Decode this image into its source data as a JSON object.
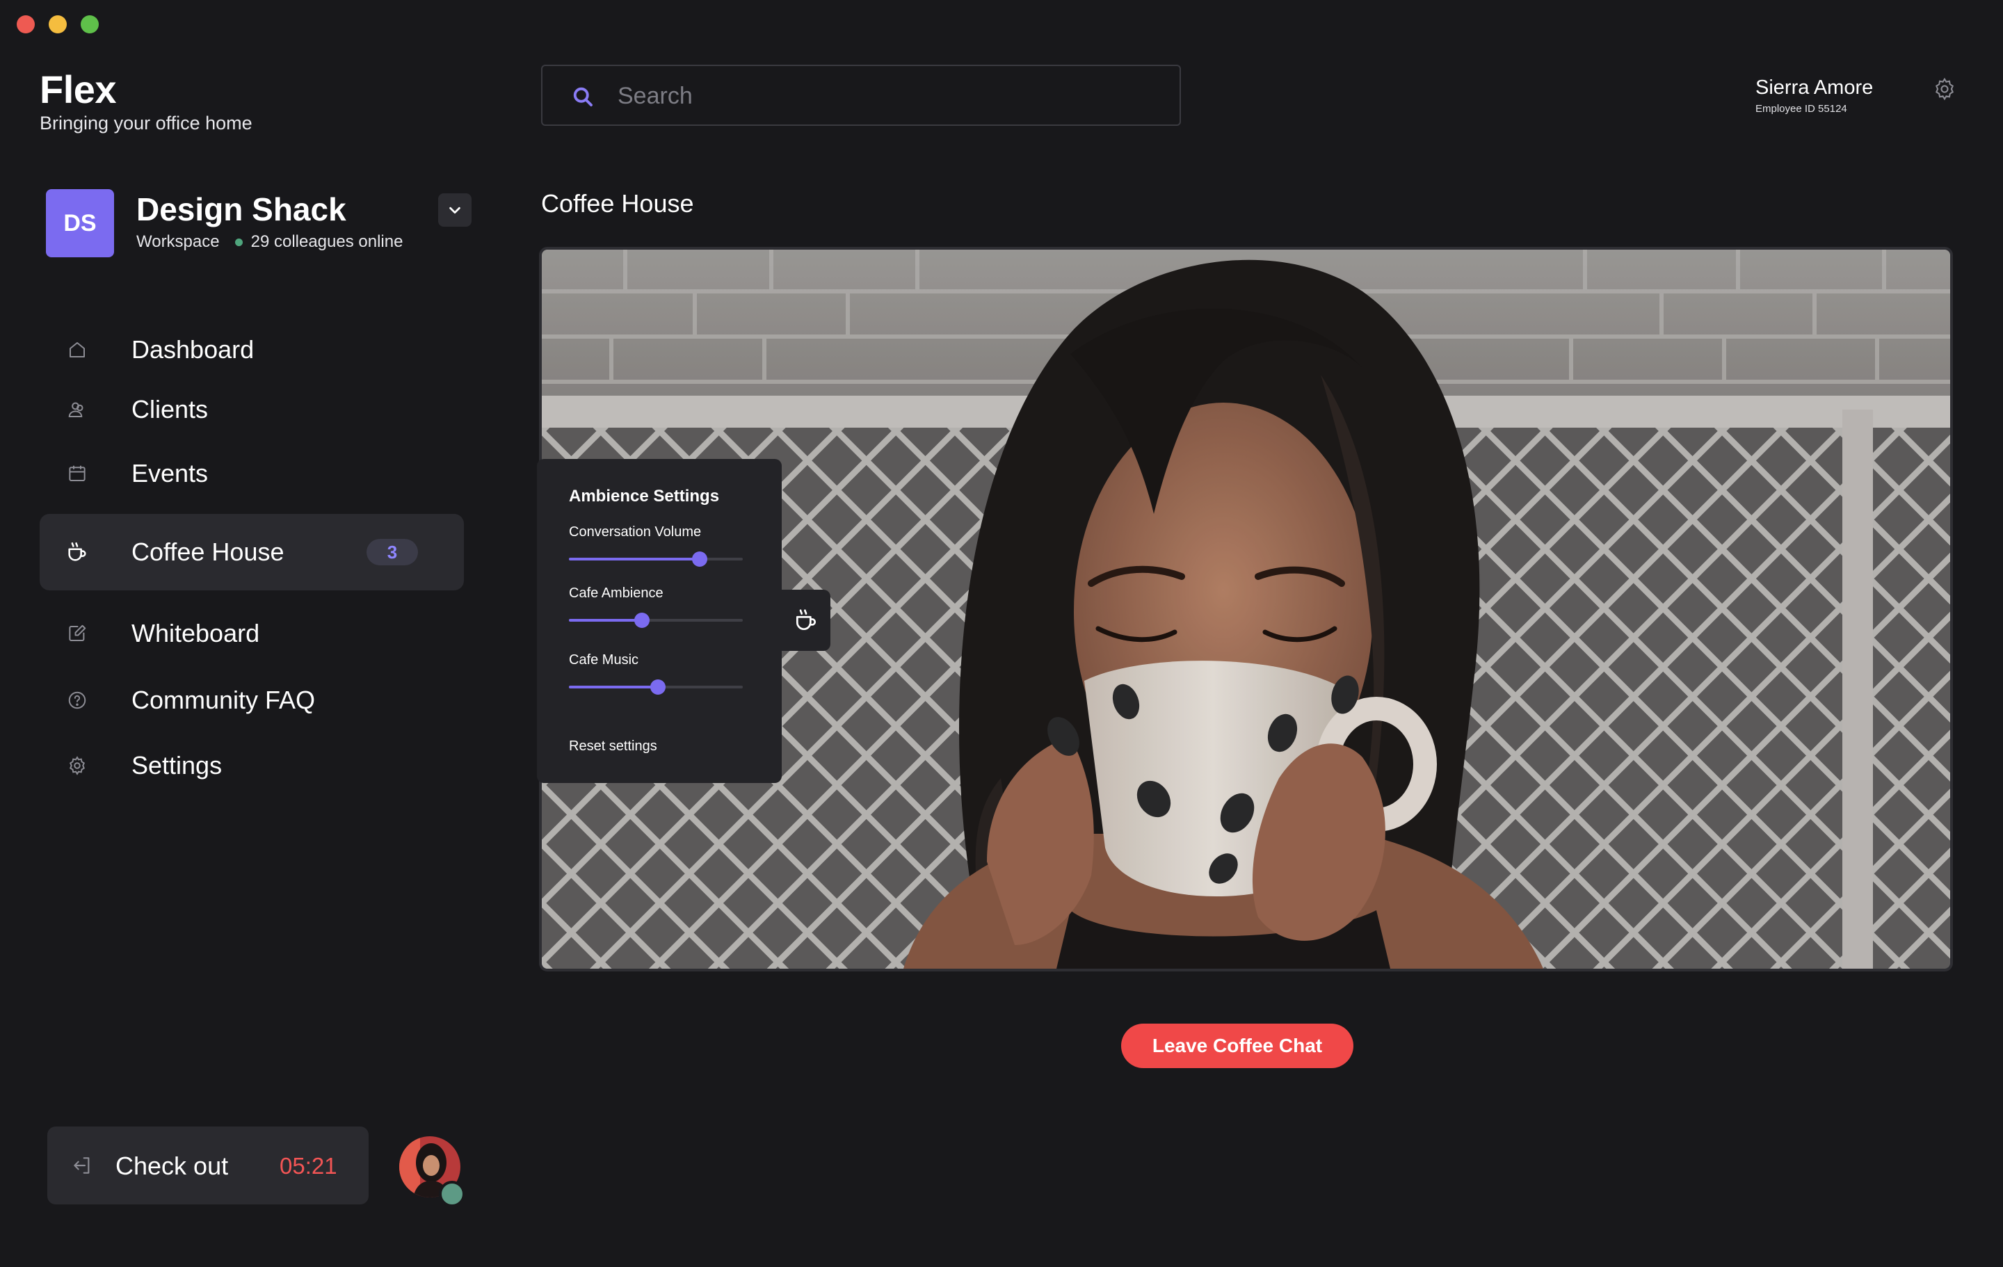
{
  "window": {
    "controls": [
      "close",
      "minimize",
      "maximize"
    ]
  },
  "brand": {
    "title": "Flex",
    "tagline": "Bringing your office home"
  },
  "workspace": {
    "initials": "DS",
    "name": "Design Shack",
    "type": "Workspace",
    "online": "29 colleagues online"
  },
  "search": {
    "placeholder": "Search",
    "value": ""
  },
  "user": {
    "name": "Sierra Amore",
    "employee_id": "Employee ID 55124"
  },
  "nav": {
    "items": [
      {
        "label": "Dashboard",
        "icon": "home-icon"
      },
      {
        "label": "Clients",
        "icon": "users-icon"
      },
      {
        "label": "Events",
        "icon": "calendar-icon"
      },
      {
        "label": "Coffee House",
        "icon": "coffee-cup-icon",
        "badge": "3",
        "active": true
      },
      {
        "label": "Whiteboard",
        "icon": "edit-icon"
      },
      {
        "label": "Community FAQ",
        "icon": "help-circle-icon"
      },
      {
        "label": "Settings",
        "icon": "gear-icon"
      }
    ]
  },
  "checkout": {
    "label": "Check out",
    "timer": "05:21"
  },
  "main": {
    "title": "Coffee House",
    "leave_button": "Leave Coffee Chat"
  },
  "ambience": {
    "title": "Ambience Settings",
    "sliders": [
      {
        "label": "Conversation Volume",
        "value": 0.75
      },
      {
        "label": "Cafe Ambience",
        "value": 0.42
      },
      {
        "label": "Cafe Music",
        "value": 0.51
      }
    ],
    "reset": "Reset settings"
  },
  "colors": {
    "accent": "#7b6bf0",
    "danger": "#f04848",
    "background": "#18181b",
    "online": "#4fa57d"
  }
}
